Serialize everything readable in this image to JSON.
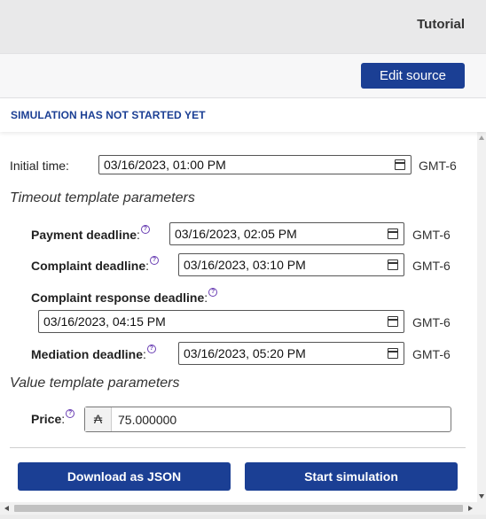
{
  "header": {
    "title": "Tutorial"
  },
  "toolbar": {
    "edit_source_label": "Edit source"
  },
  "status": {
    "text": "SIMULATION HAS NOT STARTED YET"
  },
  "initial_time": {
    "label": "Initial time:",
    "value": "03/16/2023, 01:00 PM",
    "timezone": "GMT-6"
  },
  "timeout_section": {
    "title": "Timeout template parameters",
    "params": [
      {
        "name": "Payment deadline",
        "value": "03/16/2023, 02:05 PM",
        "timezone": "GMT-6"
      },
      {
        "name": "Complaint deadline",
        "value": "03/16/2023, 03:10 PM",
        "timezone": "GMT-6"
      },
      {
        "name": "Complaint response deadline",
        "value": "03/16/2023, 04:15 PM",
        "timezone": "GMT-6"
      },
      {
        "name": "Mediation deadline",
        "value": "03/16/2023, 05:20 PM",
        "timezone": "GMT-6"
      }
    ]
  },
  "value_section": {
    "title": "Value template parameters",
    "price": {
      "name": "Price",
      "currency": "₳",
      "value": "75.000000"
    }
  },
  "actions": {
    "download_label": "Download as JSON",
    "start_label": "Start simulation"
  },
  "help_glyph": "?",
  "colon": ":",
  "colors": {
    "primary": "#1b3f94",
    "help": "#6a3fb3"
  }
}
